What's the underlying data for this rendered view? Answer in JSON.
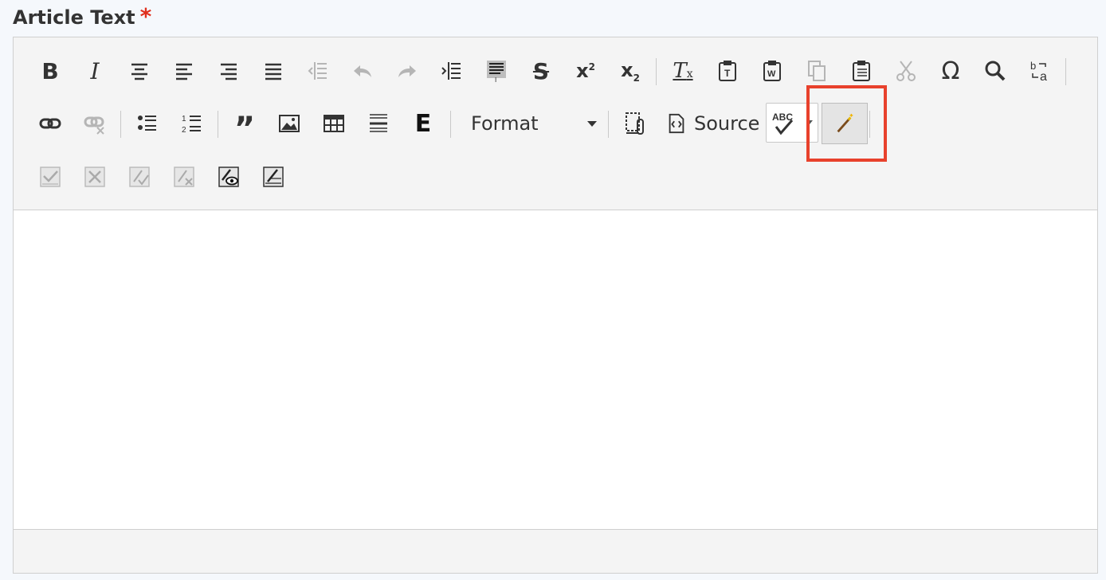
{
  "field": {
    "label": "Article Text",
    "required_marker": "*"
  },
  "toolbar": {
    "format_combo": {
      "selected": "Format"
    },
    "source_label": "Source",
    "scayt_label": "ABC"
  },
  "icons": [
    "bold-icon",
    "italic-icon",
    "align-center-icon",
    "align-left-icon",
    "align-right-icon",
    "justify-icon",
    "outdent-icon",
    "undo-icon",
    "redo-icon",
    "indent-icon",
    "show-blocks-icon",
    "strikethrough-icon",
    "superscript-icon",
    "subscript-icon",
    "remove-format-icon",
    "paste-text-icon",
    "paste-word-icon",
    "copy-icon",
    "paste-icon",
    "cut-icon",
    "omega-icon",
    "search-icon",
    "replace-icon",
    "link-icon",
    "unlink-icon",
    "bulleted-list-icon",
    "numbered-list-icon",
    "blockquote-icon",
    "image-icon",
    "table-icon",
    "horizontal-rule-icon",
    "e-icon",
    "template-icon",
    "source-icon",
    "spellcheck-icon",
    "magic-wand-icon",
    "accept-change-icon",
    "reject-change-icon",
    "accept-all-icon",
    "reject-all-icon",
    "toggle-tracking-icon",
    "show-changes-icon"
  ],
  "colors": {
    "highlight": "#e8412c",
    "required": "#e0301e"
  }
}
